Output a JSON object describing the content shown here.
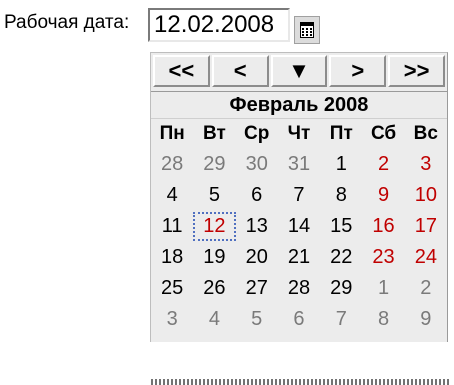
{
  "field": {
    "label": "Рабочая дата:",
    "value": "12.02.2008"
  },
  "calendar": {
    "nav": {
      "prev_year": "<<",
      "prev_month": "<",
      "today": "▼",
      "next_month": ">",
      "next_year": ">>"
    },
    "month_title": "Февраль 2008",
    "weekdays": [
      "Пн",
      "Вт",
      "Ср",
      "Чт",
      "Пт",
      "Сб",
      "Вс"
    ],
    "weeks": [
      [
        {
          "d": "28",
          "other": true
        },
        {
          "d": "29",
          "other": true
        },
        {
          "d": "30",
          "other": true
        },
        {
          "d": "31",
          "other": true
        },
        {
          "d": "1"
        },
        {
          "d": "2",
          "we": true
        },
        {
          "d": "3",
          "we": true
        }
      ],
      [
        {
          "d": "4"
        },
        {
          "d": "5"
        },
        {
          "d": "6"
        },
        {
          "d": "7"
        },
        {
          "d": "8"
        },
        {
          "d": "9",
          "we": true
        },
        {
          "d": "10",
          "we": true
        }
      ],
      [
        {
          "d": "11"
        },
        {
          "d": "12",
          "today": true
        },
        {
          "d": "13"
        },
        {
          "d": "14"
        },
        {
          "d": "15"
        },
        {
          "d": "16",
          "we": true
        },
        {
          "d": "17",
          "we": true
        }
      ],
      [
        {
          "d": "18"
        },
        {
          "d": "19"
        },
        {
          "d": "20"
        },
        {
          "d": "21"
        },
        {
          "d": "22"
        },
        {
          "d": "23",
          "we": true
        },
        {
          "d": "24",
          "we": true
        }
      ],
      [
        {
          "d": "25"
        },
        {
          "d": "26"
        },
        {
          "d": "27"
        },
        {
          "d": "28"
        },
        {
          "d": "29"
        },
        {
          "d": "1",
          "other": true,
          "we": true
        },
        {
          "d": "2",
          "other": true,
          "we": true
        }
      ],
      [
        {
          "d": "3",
          "other": true
        },
        {
          "d": "4",
          "other": true
        },
        {
          "d": "5",
          "other": true
        },
        {
          "d": "6",
          "other": true
        },
        {
          "d": "7",
          "other": true
        },
        {
          "d": "8",
          "other": true,
          "we": true
        },
        {
          "d": "9",
          "other": true,
          "we": true
        }
      ]
    ]
  },
  "colors": {
    "weekend": "#c00000",
    "other_month": "#7a7a7a",
    "today_outline": "#5070c0"
  },
  "icons": {
    "calendar_button": "calendar-icon"
  }
}
